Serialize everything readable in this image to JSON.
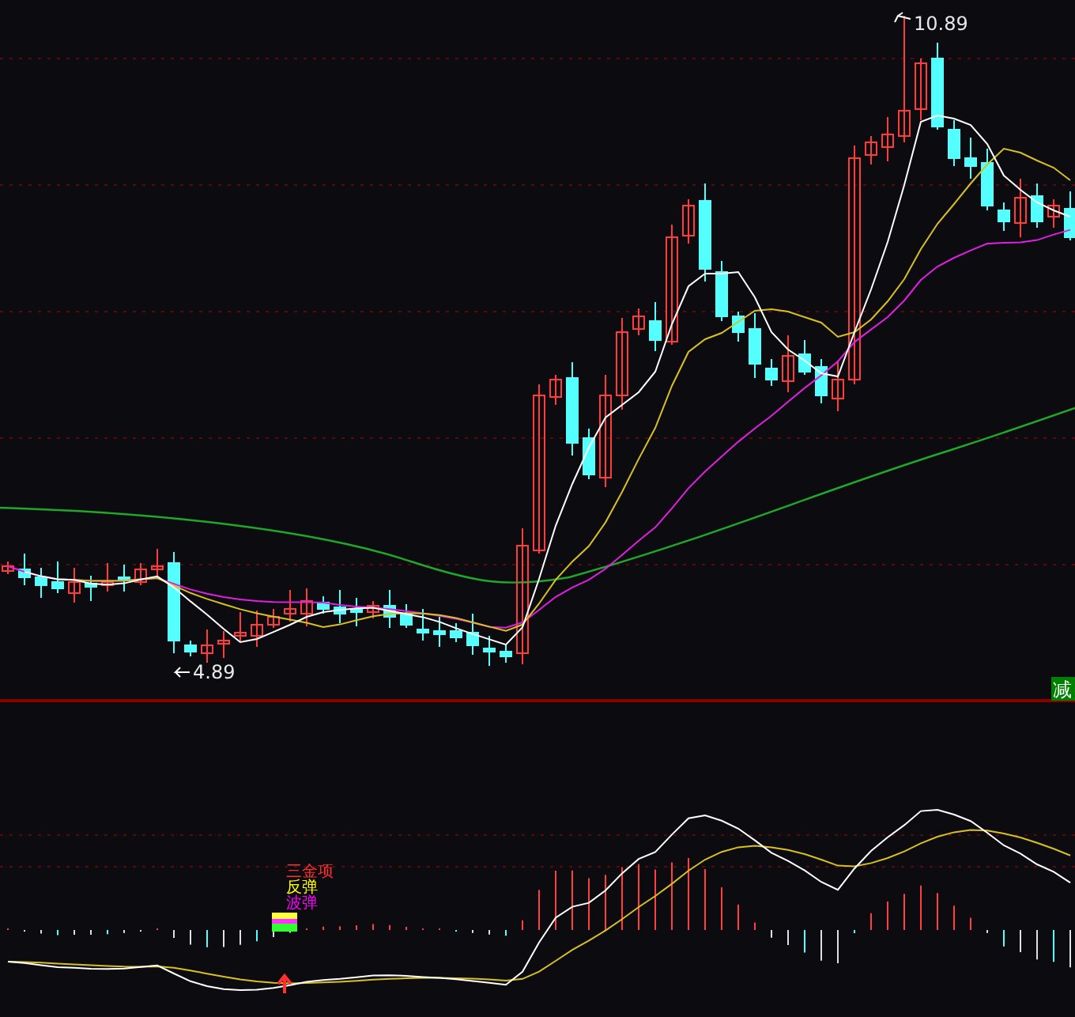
{
  "price_panel": {
    "high_label": "10.89",
    "low_label": "4.89",
    "badge": "减"
  },
  "indicator_panel": {
    "signals": [
      {
        "label": "三金项",
        "color": "#ff3030"
      },
      {
        "label": "反弹",
        "color": "#ffff00"
      },
      {
        "label": "波弹",
        "color": "#ff00ff"
      }
    ]
  }
}
